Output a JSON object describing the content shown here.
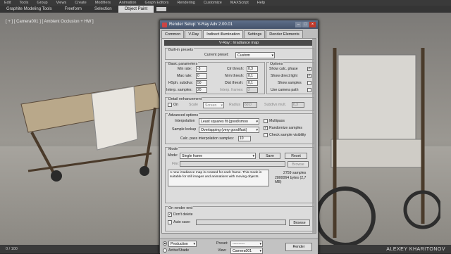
{
  "menu": [
    "Edit",
    "Tools",
    "Group",
    "Views",
    "Create",
    "Modifiers",
    "Animation",
    "Graph Editors",
    "Rendering",
    "Customize",
    "MAXScript",
    "Help"
  ],
  "ribbon": {
    "tabs": [
      "Graphite Modeling Tools",
      "Freeform",
      "Selection",
      "Object Paint"
    ]
  },
  "viewport": {
    "label": "[ + ] [ Camera001 ] [ Ambient Occlusion + HW ]"
  },
  "status": {
    "time_slider": "0 / 100",
    "credit": "ALEXEY KHARITONOV"
  },
  "dialog": {
    "title": "Render Setup: V-Ray Adv 2.00.01",
    "tabs": [
      "Common",
      "V-Ray",
      "Indirect illumination",
      "Settings",
      "Render Elements"
    ],
    "rollout": "V-Ray:: Irradiance map",
    "builtin": {
      "title": "Built-in presets",
      "current_label": "Current preset:",
      "current_value": "Custom"
    },
    "basic": {
      "title": "Basic parameters",
      "min_rate_label": "Min rate:",
      "min_rate": "-3",
      "max_rate_label": "Max rate:",
      "max_rate": "0",
      "hsph_label": "HSph. subdivs:",
      "hsph": "50",
      "interp_label": "Interp. samples:",
      "interp": "20",
      "clr_label": "Clr thresh:",
      "clr": "0,3",
      "nrm_label": "Nrm thresh:",
      "nrm": "0,1",
      "dist_label": "Dist thresh:",
      "dist": "0,1",
      "interp_frames_label": "Interp. frames:",
      "interp_frames": "2"
    },
    "options": {
      "title": "Options",
      "show_calc": "Show calc. phase",
      "show_direct": "Show direct light",
      "show_samples": "Show samples",
      "use_camera": "Use camera path"
    },
    "detail": {
      "title": "Detail enhancement",
      "on": "On",
      "scale_label": "Scale",
      "scale_value": "Screen",
      "radius_label": "Radius",
      "radius": "60,0",
      "subdivs_label": "Subdivs mult.",
      "subdivs": "0,3"
    },
    "advanced": {
      "title": "Advanced options",
      "interp_label": "Interpolation",
      "interp_value": "Least squares fit (good/smoo",
      "lookup_label": "Sample lookup",
      "lookup_value": "Overlapping (very good/fast)",
      "calc_label": "Calc. pass interpolation samples:",
      "calc_value": "10",
      "multipass": "Multipass",
      "randomize": "Randomize samples",
      "check_vis": "Check sample visibility"
    },
    "mode": {
      "title": "Mode",
      "mode_label": "Mode:",
      "mode_value": "Single frame",
      "save": "Save",
      "reset": "Reset",
      "file_label": "File:",
      "browse": "Browse",
      "description": "A new irradiance map is created for each frame. This mode is suitable for still images and animations with moving objects.",
      "samples": "2759 samples",
      "bytes": "2800064 bytes (2,7 MB)"
    },
    "render_end": {
      "title": "On render end",
      "dont_delete": "Don't delete",
      "auto_save": "Auto save:",
      "browse": "Browse"
    },
    "bottom": {
      "production": "Production",
      "activeshade": "ActiveShade",
      "preset_label": "Preset:",
      "preset_value": "----------",
      "view_label": "View:",
      "view_value": "Camera001",
      "render": "Render"
    }
  }
}
